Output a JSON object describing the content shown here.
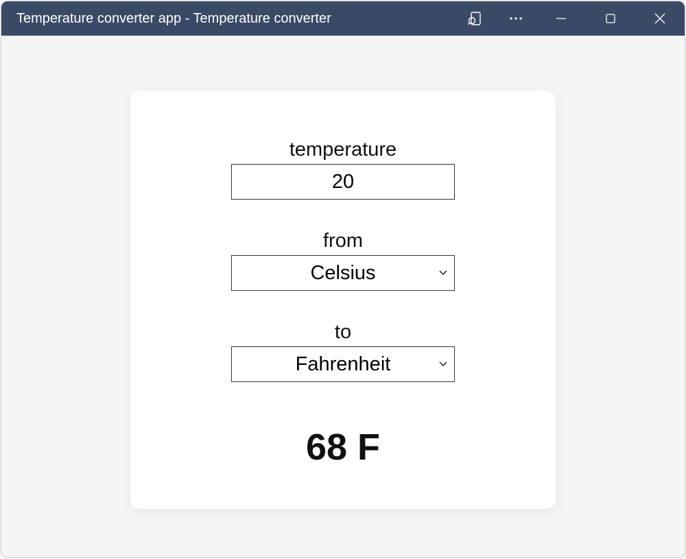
{
  "window": {
    "title": "Temperature converter app - Temperature converter"
  },
  "form": {
    "temperature": {
      "label": "temperature",
      "value": "20"
    },
    "from": {
      "label": "from",
      "value": "Celsius"
    },
    "to": {
      "label": "to",
      "value": "Fahrenheit"
    }
  },
  "result": {
    "text": "68 F"
  }
}
